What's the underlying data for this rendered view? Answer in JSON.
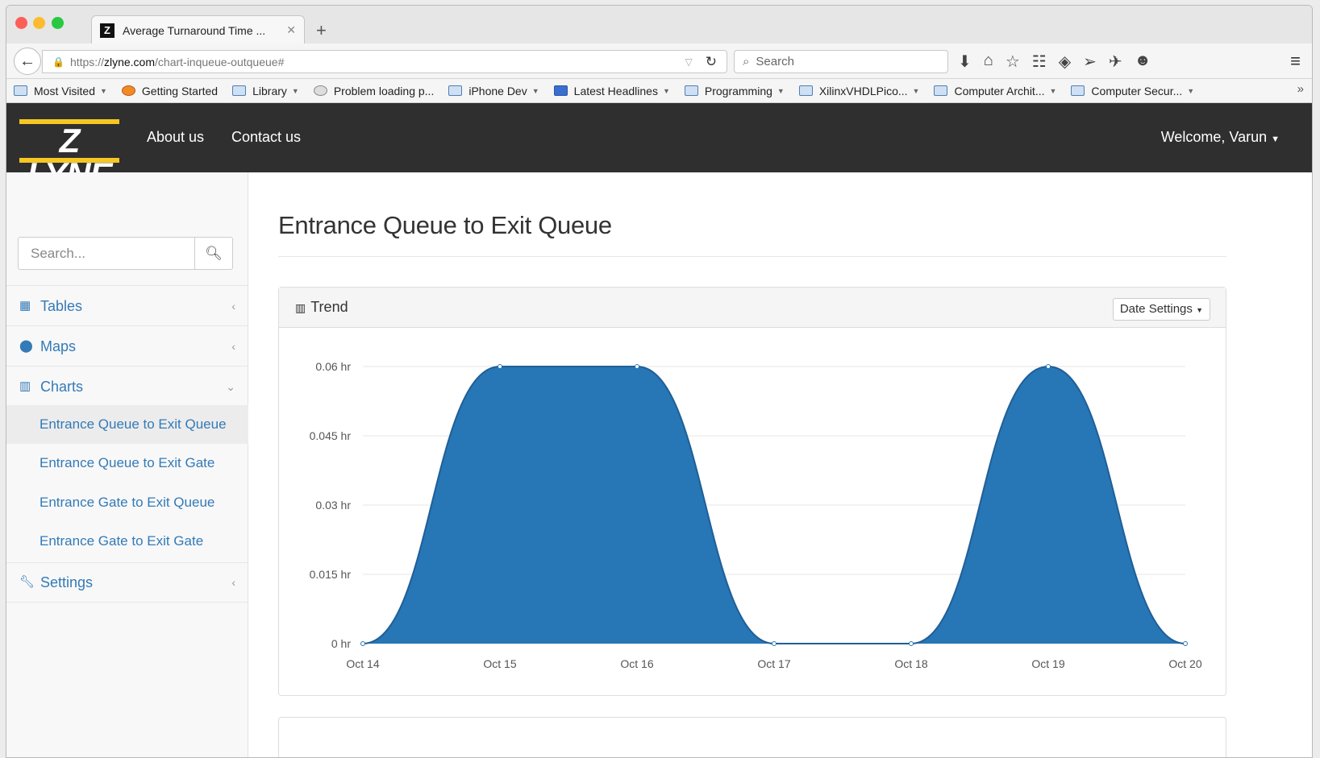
{
  "browser": {
    "tab_title": "Average Turnaround Time ...",
    "tab_favicon": "Z",
    "new_tab": "+",
    "url_prefix": "https://",
    "url_domain": "zlyne.com",
    "url_path": "/chart-inqueue-outqueue#",
    "search_placeholder": "Search",
    "bookmarks": [
      {
        "label": "Most Visited",
        "menu": true
      },
      {
        "label": "Getting Started",
        "menu": false
      },
      {
        "label": "Library",
        "menu": true
      },
      {
        "label": "Problem loading p...",
        "menu": false
      },
      {
        "label": "iPhone Dev",
        "menu": true
      },
      {
        "label": "Latest Headlines",
        "menu": true
      },
      {
        "label": "Programming",
        "menu": true
      },
      {
        "label": "XilinxVHDLPico...",
        "menu": true
      },
      {
        "label": "Computer Archit...",
        "menu": true
      },
      {
        "label": "Computer Secur...",
        "menu": true
      }
    ]
  },
  "site": {
    "logo_text": "Z LYNE",
    "nav": {
      "about": "About us",
      "contact": "Contact us"
    },
    "welcome": "Welcome, Varun",
    "accent": "#337ab7",
    "brand_yellow": "#f6c623"
  },
  "sidebar": {
    "search_placeholder": "Search...",
    "items": [
      {
        "label": "Tables",
        "icon": "table-icon"
      },
      {
        "label": "Maps",
        "icon": "map-marker-icon"
      },
      {
        "label": "Charts",
        "icon": "bar-chart-icon"
      },
      {
        "label": "Settings",
        "icon": "wrench-icon"
      }
    ],
    "sub_items": [
      "Entrance Queue to Exit Queue",
      "Entrance Queue to Exit Gate",
      "Entrance Gate to Exit Queue",
      "Entrance Gate to Exit Gate"
    ],
    "active_sub": "Entrance Queue to Exit Queue"
  },
  "main": {
    "title": "Entrance Queue to Exit Queue",
    "panel_title": "Trend",
    "date_settings": "Date Settings"
  },
  "chart_data": {
    "type": "area",
    "categories": [
      "Oct 14",
      "Oct 15",
      "Oct 16",
      "Oct 17",
      "Oct 18",
      "Oct 19",
      "Oct 20"
    ],
    "values": [
      0,
      0.06,
      0.06,
      0,
      0,
      0.06,
      0
    ],
    "yticks": [
      "0 hr",
      "0.015 hr",
      "0.03 hr",
      "0.045 hr",
      "0.06 hr"
    ],
    "ytick_values": [
      0,
      0.015,
      0.03,
      0.045,
      0.06
    ],
    "ylim": [
      0,
      0.06
    ],
    "grid": true,
    "color": "#2776b5"
  }
}
